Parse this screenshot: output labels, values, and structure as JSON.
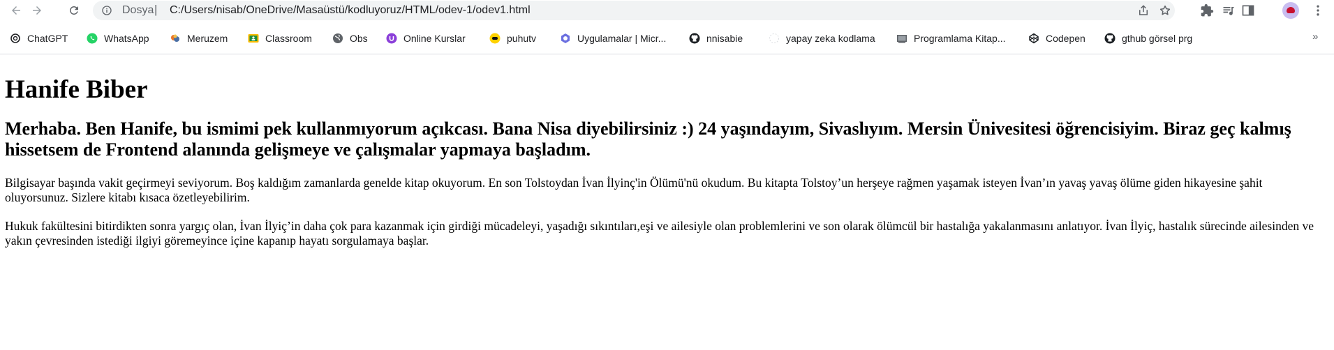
{
  "browser": {
    "omnibox": {
      "scheme_label": "Dosya",
      "separator": "|",
      "url": "C:/Users/nisab/OneDrive/Masaüstü/kodluyoruz/HTML/odev-1/odev1.html"
    },
    "icons": [
      "back-icon",
      "forward-icon",
      "reload-icon",
      "info-icon",
      "share-icon",
      "bookmark-star-icon",
      "extensions-icon",
      "media-icon",
      "side-panel-icon",
      "profile-avatar",
      "more-menu-icon"
    ]
  },
  "bookmarks": {
    "items": [
      {
        "label": "ChatGPT",
        "icon": "chatgpt-icon"
      },
      {
        "label": "WhatsApp",
        "icon": "whatsapp-icon"
      },
      {
        "label": "Meruzem",
        "icon": "meruzem-icon"
      },
      {
        "label": "Classroom",
        "icon": "classroom-icon"
      },
      {
        "label": "Obs",
        "icon": "globe-icon"
      },
      {
        "label": "Online Kurslar",
        "icon": "online-kurslar-icon"
      },
      {
        "label": "puhutv",
        "icon": "puhutv-icon"
      },
      {
        "label": "Uygulamalar | Micr...",
        "icon": "microsoft-apps-icon"
      },
      {
        "label": "nnisabie",
        "icon": "github-icon"
      },
      {
        "label": "yapay zeka kodlama",
        "icon": "blank-page-icon"
      },
      {
        "label": "Programlama Kitap...",
        "icon": "book-icon"
      },
      {
        "label": "Codepen",
        "icon": "codepen-icon"
      },
      {
        "label": "gthub görsel prg",
        "icon": "github-icon"
      }
    ],
    "overflow": "»"
  },
  "page": {
    "heading": "Hanife Biber",
    "subheading": "Merhaba. Ben Hanife, bu ismimi pek kullanmıyorum açıkcası. Bana Nisa diyebilirsiniz :) 24 yaşındayım, Sivaslıyım. Mersin Ünivesitesi öğrencisiyim. Biraz geç kalmış hissetsem de Frontend alanında gelişmeye ve çalışmalar yapmaya başladım.",
    "paragraph_1": "Bilgisayar başında vakit geçirmeyi seviyorum. Boş kaldığım zamanlarda genelde kitap okuyorum. En son Tolstoydan İvan İlyinç'in Ölümü'nü okudum. Bu kitapta Tolstoy’un herşeye rağmen yaşamak isteyen İvan’ın yavaş yavaş ölüme giden hikayesine şahit oluyorsunuz. Sizlere kitabı kısaca özetleyebilirim.",
    "paragraph_2": "Hukuk fakültesini bitirdikten sonra yargıç olan, İvan İlyiç’in daha çok para kazanmak için girdiği mücadeleyi, yaşadığı sıkıntıları,eşi ve ailesiyle olan problemlerini ve son olarak ölümcül bir hastalığa yakalanmasını anlatıyor. İvan İlyiç, hastalık sürecinde ailesinden ve yakın çevresinden istediği ilgiyi göremeyince içine kapanıp hayatı sorgulamaya başlar."
  }
}
